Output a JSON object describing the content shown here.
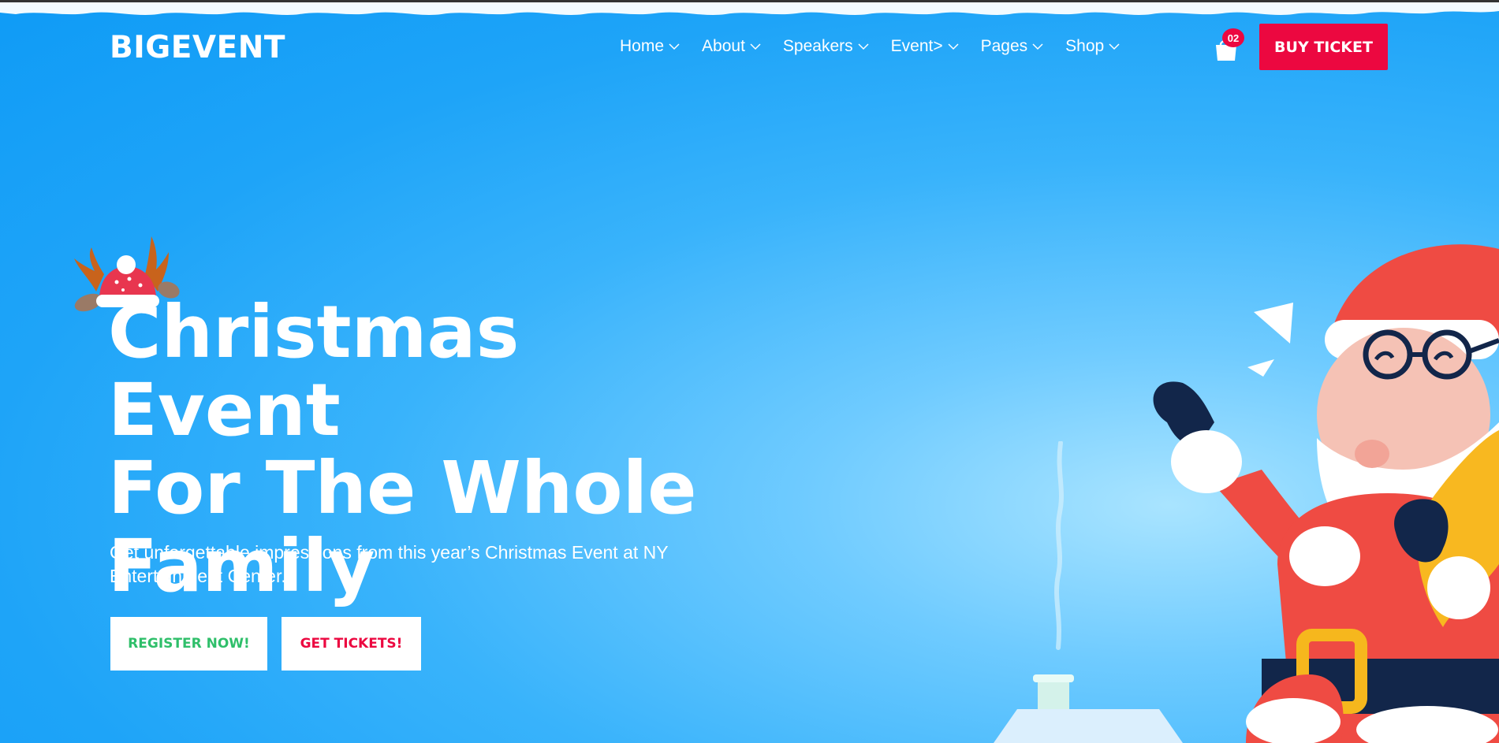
{
  "brand": {
    "logo": "BIGEVENT"
  },
  "nav": {
    "items": [
      {
        "label": "Home"
      },
      {
        "label": "About"
      },
      {
        "label": "Speakers"
      },
      {
        "label": "Event>"
      },
      {
        "label": "Pages"
      },
      {
        "label": "Shop"
      }
    ]
  },
  "cart": {
    "count": "02",
    "icon": "shopping-bag-icon"
  },
  "header": {
    "buy_ticket_label": "BUY TICKET"
  },
  "hero": {
    "title_line1": "Christmas Event",
    "title_line2": "For The Whole",
    "title_line3": "Family",
    "subtitle": "Get unforgettable impressions from this year’s Christmas Event at NY Entertainment Center.",
    "register_label": "REGISTER NOW!",
    "tickets_label": "GET TICKETS!"
  },
  "colors": {
    "accent": "#ec0840",
    "success": "#2fbf6a",
    "background": "#1ea4f8"
  }
}
